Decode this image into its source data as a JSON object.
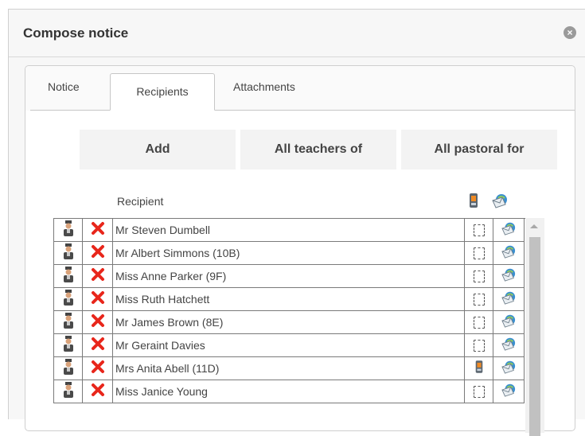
{
  "dialog": {
    "title": "Compose notice",
    "close_icon": "close-circle-icon"
  },
  "tabs": [
    {
      "label": "Notice",
      "active": false
    },
    {
      "label": "Recipients",
      "active": true
    },
    {
      "label": "Attachments",
      "active": false
    }
  ],
  "buttons": {
    "add": "Add",
    "all_teachers": "All teachers of",
    "all_pastoral": "All pastoral for"
  },
  "table": {
    "header_recipient": "Recipient",
    "header_sms_icon": "mobile-phone-icon",
    "header_email_icon": "envelope-globe-icon",
    "rows": [
      {
        "name": "Mr Steven Dumbell",
        "sms": "checkbox"
      },
      {
        "name": "Mr Albert Simmons (10B)",
        "sms": "checkbox"
      },
      {
        "name": "Miss Anne Parker (9F)",
        "sms": "checkbox"
      },
      {
        "name": "Miss Ruth Hatchett",
        "sms": "checkbox"
      },
      {
        "name": "Mr James Brown (8E)",
        "sms": "checkbox"
      },
      {
        "name": "Mr Geraint Davies",
        "sms": "checkbox"
      },
      {
        "name": "Mrs Anita Abell (11D)",
        "sms": "phone"
      },
      {
        "name": "Miss Janice Young",
        "sms": "checkbox"
      }
    ]
  },
  "colors": {
    "delete": "#e8261b",
    "accent_email": "#3a8fd0"
  }
}
